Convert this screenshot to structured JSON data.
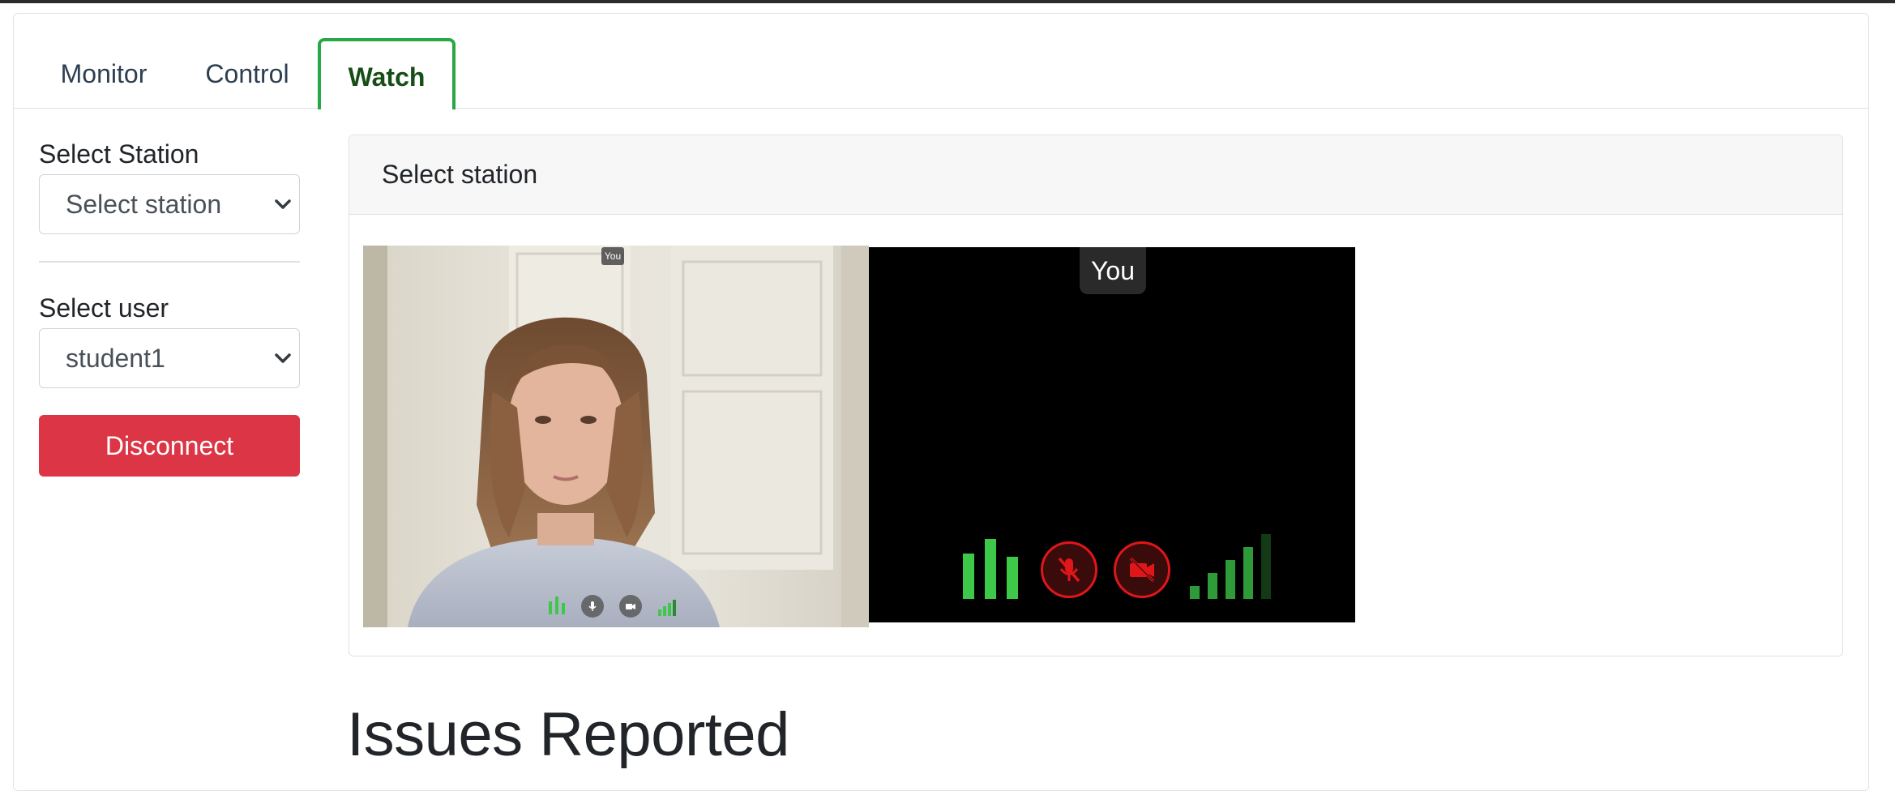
{
  "tabs": {
    "monitor": "Monitor",
    "control": "Control",
    "watch": "Watch",
    "active": "Watch"
  },
  "sidebar": {
    "station_label": "Select Station",
    "station_value": "Select station",
    "user_label": "Select user",
    "user_value": "student1",
    "disconnect_label": "Disconnect"
  },
  "panel": {
    "header": "Select station",
    "main_video": {
      "you_label": "You",
      "controls": [
        "audio-level-icon",
        "microphone-icon",
        "camera-icon",
        "signal-strength-icon"
      ]
    },
    "self_video": {
      "you_label": "You",
      "controls": [
        "audio-level-icon",
        "microphone-muted-icon",
        "camera-off-icon",
        "signal-strength-icon"
      ],
      "mic_muted": true,
      "camera_off": true
    }
  },
  "issues": {
    "title": "Issues Reported"
  },
  "colors": {
    "active_tab_border": "#28a745",
    "danger": "#dc3545",
    "audio_bars": "#3ec84a",
    "muted_red": "#e0161b"
  }
}
